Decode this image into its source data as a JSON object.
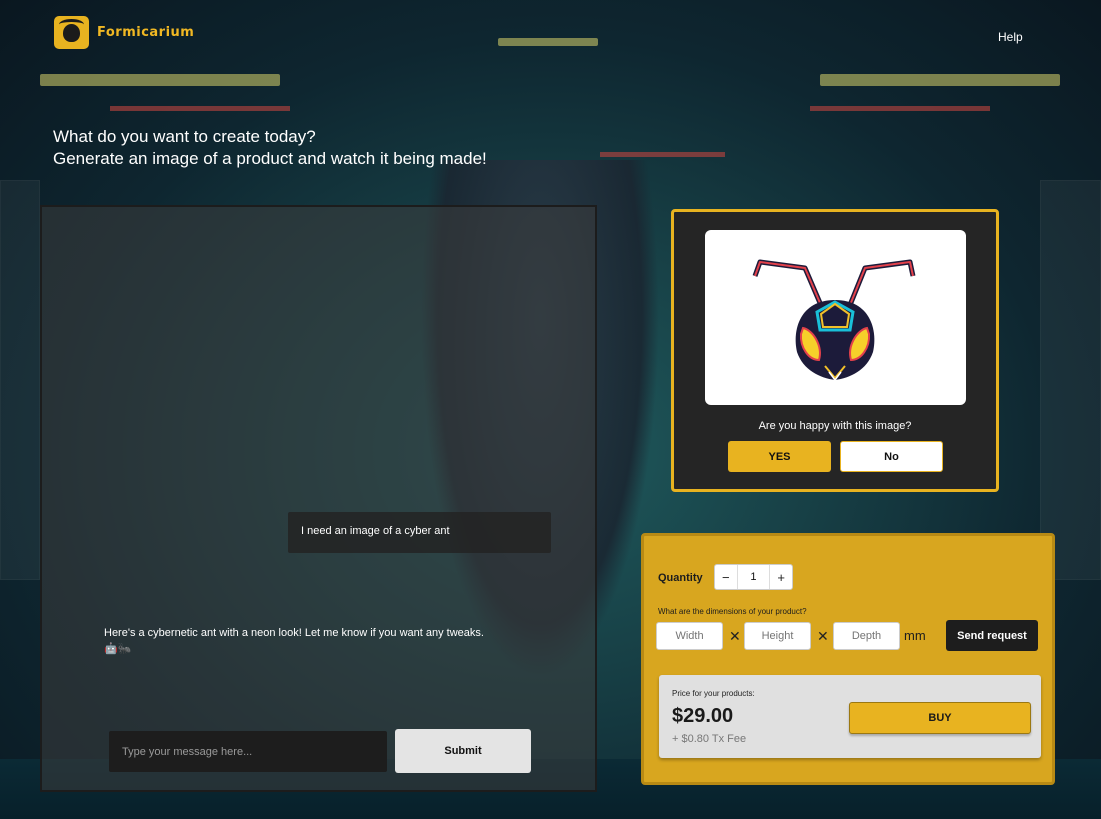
{
  "header": {
    "brand": "Formicarium",
    "help_label": "Help"
  },
  "headline": {
    "line1": "What do you want to create today?",
    "line2": "Generate an image of a product and watch it being made!"
  },
  "chat": {
    "user_message": "I need an image of a cyber ant",
    "bot_message": "Here's a cybernetic ant with a neon look! Let me know if you want any tweaks. 🤖🐜",
    "input_placeholder": "Type your message here...",
    "submit_label": "Submit"
  },
  "preview": {
    "question": "Are you happy with this image?",
    "yes_label": "YES",
    "no_label": "No"
  },
  "order": {
    "quantity_label": "Quantity",
    "quantity_value": "1",
    "dimensions_label": "What are the dimensions of your product?",
    "width_placeholder": "Width",
    "height_placeholder": "Height",
    "depth_placeholder": "Depth",
    "unit": "mm",
    "send_label": "Send request",
    "price_label": "Price for your products:",
    "price_value": "$29.00",
    "fee": "+ $0.80 Tx Fee",
    "buy_label": "BUY"
  },
  "colors": {
    "accent": "#e8b320",
    "dark": "#1d1d1d"
  }
}
